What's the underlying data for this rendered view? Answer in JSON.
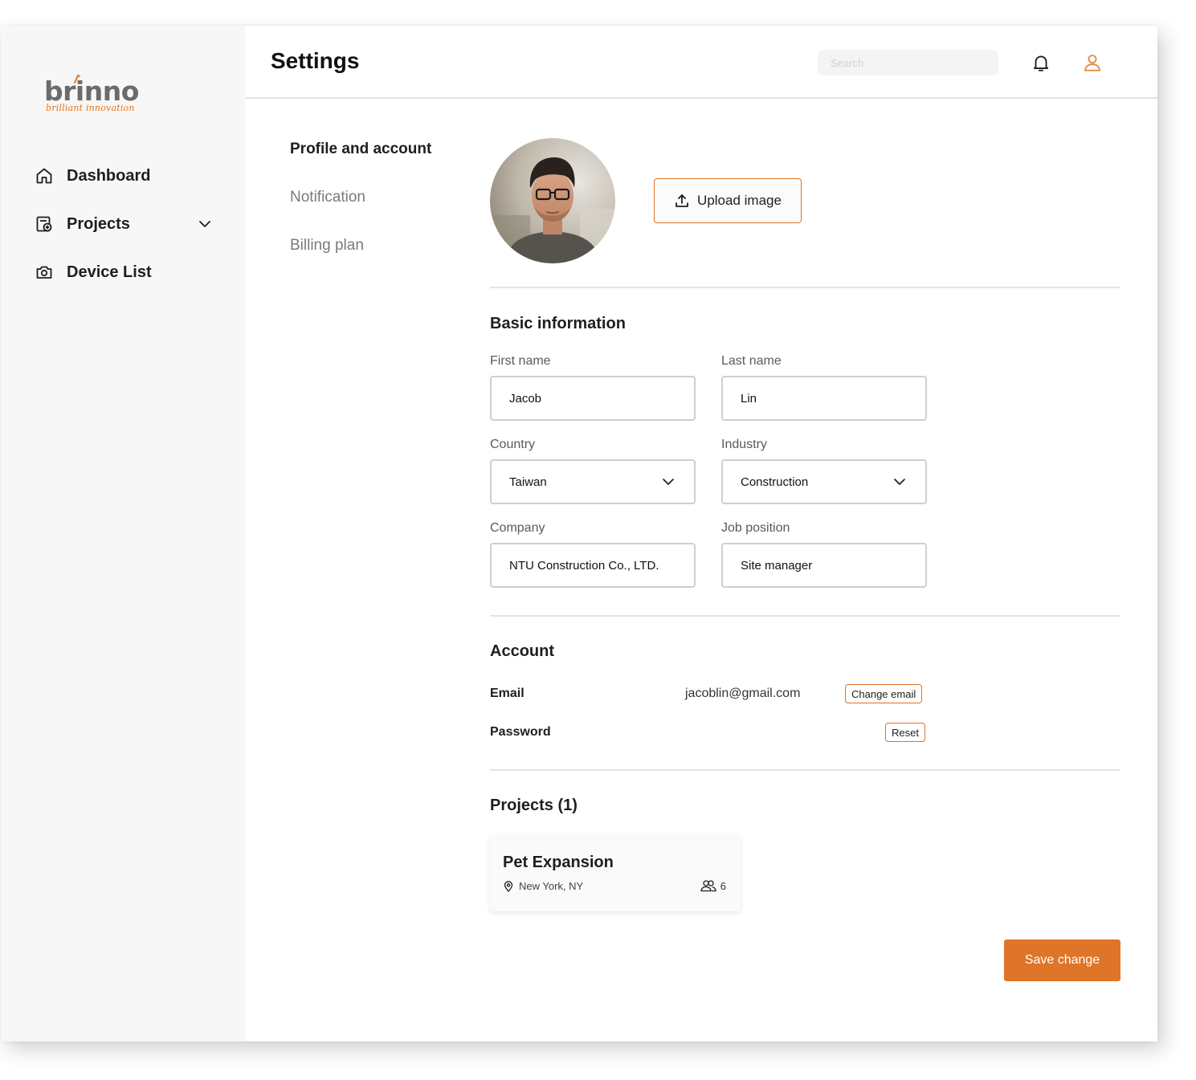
{
  "brand": {
    "name": "brinno",
    "tagline": "brilliant innovation",
    "accent_color": "#df7528"
  },
  "sidebar": {
    "items": [
      {
        "label": "Dashboard",
        "icon": "home-icon"
      },
      {
        "label": "Projects",
        "icon": "projects-icon",
        "expandable": true
      },
      {
        "label": "Device List",
        "icon": "camera-icon"
      }
    ]
  },
  "header": {
    "title": "Settings",
    "search_placeholder": "Search",
    "icons": [
      "bell-icon",
      "user-icon"
    ]
  },
  "settings_nav": {
    "items": [
      {
        "label": "Profile and account",
        "active": true
      },
      {
        "label": "Notification",
        "active": false
      },
      {
        "label": "Billing plan",
        "active": false
      }
    ]
  },
  "profile": {
    "upload_label": "Upload image"
  },
  "basic_info": {
    "title": "Basic information",
    "first_name_label": "First name",
    "first_name": "Jacob",
    "last_name_label": "Last name",
    "last_name": "Lin",
    "country_label": "Country",
    "country": "Taiwan",
    "industry_label": "Industry",
    "industry": "Construction",
    "company_label": "Company",
    "company": "NTU Construction Co., LTD.",
    "job_label": "Job position",
    "job": "Site manager"
  },
  "account": {
    "title": "Account",
    "email_label": "Email",
    "email": "jacoblin@gmail.com",
    "change_email_label": "Change email",
    "password_label": "Password",
    "reset_label": "Reset"
  },
  "projects": {
    "title": "Projects (1)",
    "items": [
      {
        "name": "Pet Expansion",
        "location": "New York, NY",
        "members": "6"
      }
    ]
  },
  "actions": {
    "save_label": "Save change"
  }
}
